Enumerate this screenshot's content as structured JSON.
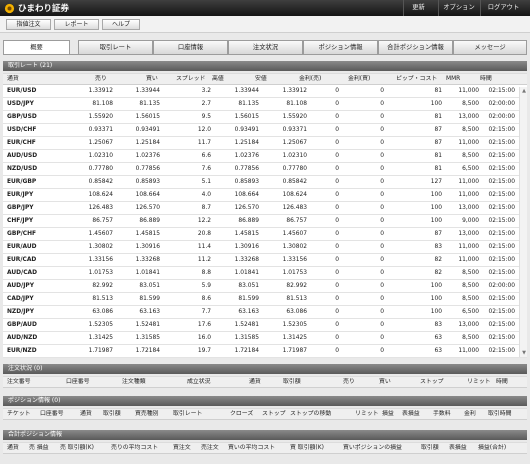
{
  "header": {
    "brand": "ひまわり証券",
    "links": [
      "更新",
      "オプション",
      "ログアウト"
    ]
  },
  "subnav": [
    "指値注文",
    "レポート",
    "ヘルプ"
  ],
  "tabs": [
    "概要",
    "取引レート",
    "口座情報",
    "注文状況",
    "ポジション情報",
    "合計ポジション情報",
    "メッセージ"
  ],
  "active_tab": 0,
  "rates": {
    "title": "取引レート (21)",
    "columns": [
      "通貨",
      "売り",
      "買い",
      "スプレッド",
      "高値",
      "安値",
      "金利(売)",
      "金利(買)",
      "ピップ・コスト",
      "MMR",
      "時間"
    ],
    "rows": [
      [
        "EUR/USD",
        "1.33912",
        "1.33944",
        "3.2",
        "1.33944",
        "1.33912",
        "0",
        "0",
        "81",
        "11,000",
        "02:15:00"
      ],
      [
        "USD/JPY",
        "81.108",
        "81.135",
        "2.7",
        "81.135",
        "81.108",
        "0",
        "0",
        "100",
        "8,500",
        "02:00:00"
      ],
      [
        "GBP/USD",
        "1.55920",
        "1.56015",
        "9.5",
        "1.56015",
        "1.55920",
        "0",
        "0",
        "81",
        "13,000",
        "02:00:00"
      ],
      [
        "USD/CHF",
        "0.93371",
        "0.93491",
        "12.0",
        "0.93491",
        "0.93371",
        "0",
        "0",
        "87",
        "8,500",
        "02:15:00"
      ],
      [
        "EUR/CHF",
        "1.25067",
        "1.25184",
        "11.7",
        "1.25184",
        "1.25067",
        "0",
        "0",
        "87",
        "11,000",
        "02:15:00"
      ],
      [
        "AUD/USD",
        "1.02310",
        "1.02376",
        "6.6",
        "1.02376",
        "1.02310",
        "0",
        "0",
        "81",
        "8,500",
        "02:15:00"
      ],
      [
        "NZD/USD",
        "0.77780",
        "0.77856",
        "7.6",
        "0.77856",
        "0.77780",
        "0",
        "0",
        "81",
        "6,500",
        "02:15:00"
      ],
      [
        "EUR/GBP",
        "0.85842",
        "0.85893",
        "5.1",
        "0.85893",
        "0.85842",
        "0",
        "0",
        "127",
        "11,000",
        "02:15:00"
      ],
      [
        "EUR/JPY",
        "108.624",
        "108.664",
        "4.0",
        "108.664",
        "108.624",
        "0",
        "0",
        "100",
        "11,000",
        "02:15:00"
      ],
      [
        "GBP/JPY",
        "126.483",
        "126.570",
        "8.7",
        "126.570",
        "126.483",
        "0",
        "0",
        "100",
        "13,000",
        "02:15:00"
      ],
      [
        "CHF/JPY",
        "86.757",
        "86.889",
        "12.2",
        "86.889",
        "86.757",
        "0",
        "0",
        "100",
        "9,000",
        "02:15:00"
      ],
      [
        "GBP/CHF",
        "1.45607",
        "1.45815",
        "20.8",
        "1.45815",
        "1.45607",
        "0",
        "0",
        "87",
        "13,000",
        "02:15:00"
      ],
      [
        "EUR/AUD",
        "1.30802",
        "1.30916",
        "11.4",
        "1.30916",
        "1.30802",
        "0",
        "0",
        "83",
        "11,000",
        "02:15:00"
      ],
      [
        "EUR/CAD",
        "1.33156",
        "1.33268",
        "11.2",
        "1.33268",
        "1.33156",
        "0",
        "0",
        "82",
        "11,000",
        "02:15:00"
      ],
      [
        "AUD/CAD",
        "1.01753",
        "1.01841",
        "8.8",
        "1.01841",
        "1.01753",
        "0",
        "0",
        "82",
        "8,500",
        "02:15:00"
      ],
      [
        "AUD/JPY",
        "82.992",
        "83.051",
        "5.9",
        "83.051",
        "82.992",
        "0",
        "0",
        "100",
        "8,500",
        "02:00:00"
      ],
      [
        "CAD/JPY",
        "81.513",
        "81.599",
        "8.6",
        "81.599",
        "81.513",
        "0",
        "0",
        "100",
        "8,500",
        "02:15:00"
      ],
      [
        "NZD/JPY",
        "63.086",
        "63.163",
        "7.7",
        "63.163",
        "63.086",
        "0",
        "0",
        "100",
        "6,500",
        "02:15:00"
      ],
      [
        "GBP/AUD",
        "1.52305",
        "1.52481",
        "17.6",
        "1.52481",
        "1.52305",
        "0",
        "0",
        "83",
        "13,000",
        "02:15:00"
      ],
      [
        "AUD/NZD",
        "1.31425",
        "1.31585",
        "16.0",
        "1.31585",
        "1.31425",
        "0",
        "0",
        "63",
        "8,500",
        "02:15:00"
      ],
      [
        "EUR/NZD",
        "1.71987",
        "1.72184",
        "19.7",
        "1.72184",
        "1.71987",
        "0",
        "0",
        "63",
        "11,000",
        "02:15:00"
      ]
    ]
  },
  "orders": {
    "title": "注文状況 (0)",
    "columns": [
      "注文番号",
      "口座番号",
      "注文種類",
      "成立状況",
      "通貨",
      "取引額",
      "売り",
      "買い",
      "ストップ",
      "リミット",
      "時間"
    ]
  },
  "positions": {
    "title": "ポジション情報 (0)",
    "columns": [
      "チケット",
      "口座番号",
      "通貨",
      "取引額",
      "買売種別",
      "取引レート",
      "クローズ",
      "ストップ",
      "ストップの移動",
      "リミット",
      "損益",
      "表損益",
      "手数料",
      "金利",
      "取引時間"
    ]
  },
  "totals": {
    "title": "合計ポジション情報",
    "columns": [
      "通貨",
      "売 損益",
      "売 取引額(K)",
      "売りの平均コスト",
      "買注文",
      "売注文",
      "買いの平均コスト",
      "買 取引額(K)",
      "買いポジションの損益",
      "取引額",
      "表損益",
      "損益(合計)"
    ]
  }
}
